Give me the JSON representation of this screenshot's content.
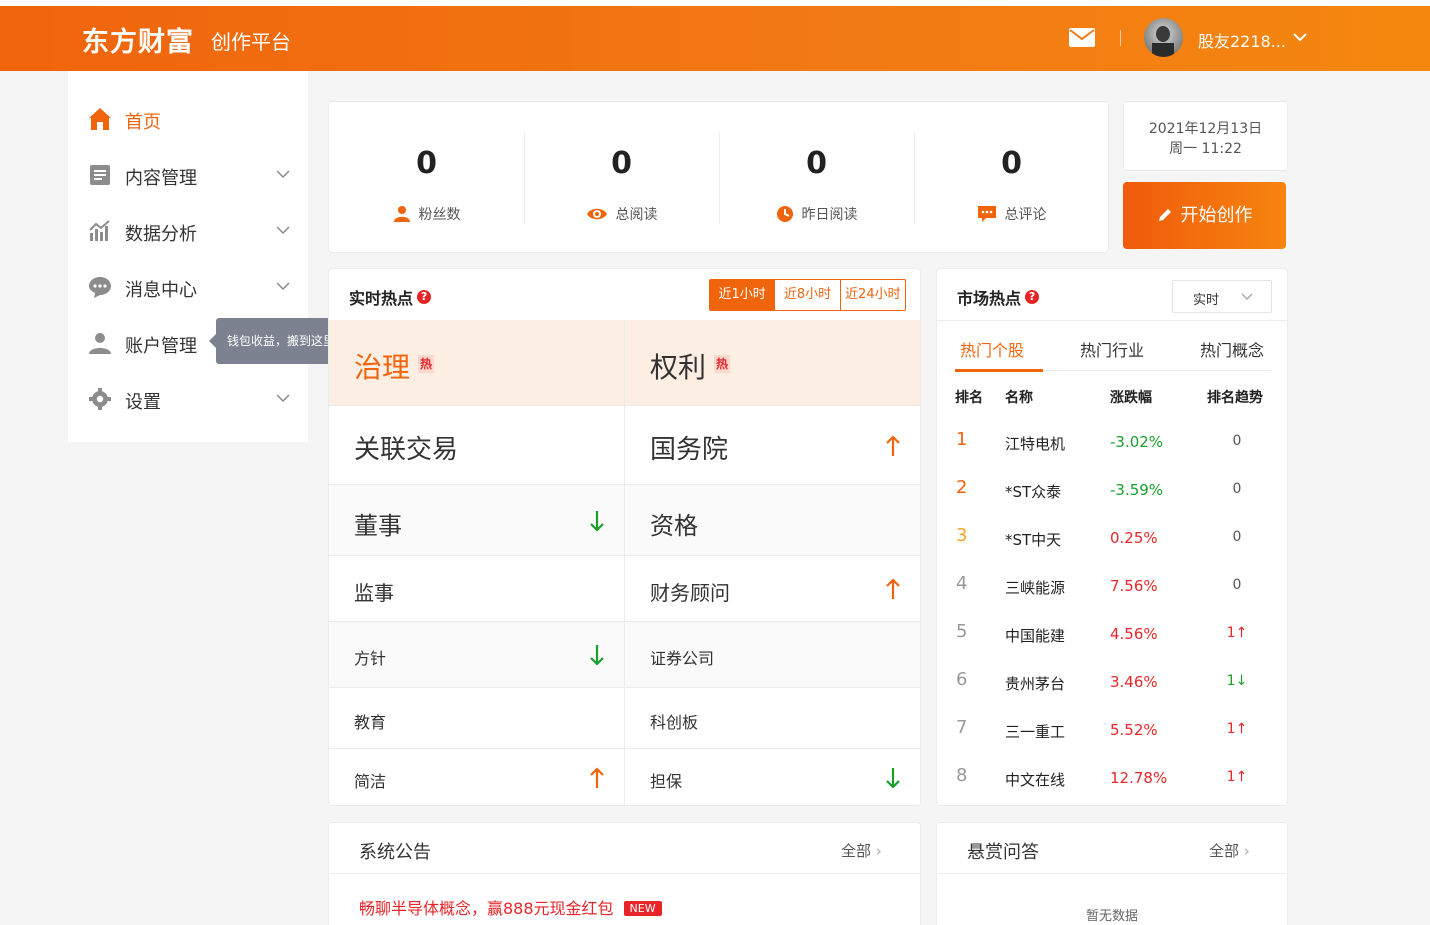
{
  "header": {
    "logo": "东方财富",
    "subtitle": "创作平台",
    "username": "股友2218..."
  },
  "sidebar": {
    "items": [
      {
        "label": "首页",
        "icon": "home-icon",
        "active": true
      },
      {
        "label": "内容管理",
        "icon": "document-icon"
      },
      {
        "label": "数据分析",
        "icon": "chart-icon"
      },
      {
        "label": "消息中心",
        "icon": "chat-icon"
      },
      {
        "label": "账户管理",
        "icon": "user-icon"
      },
      {
        "label": "设置",
        "icon": "gear-icon"
      }
    ],
    "tooltip": "钱包收益，搬到这里了!"
  },
  "stats": [
    {
      "value": "0",
      "label": "粉丝数",
      "icon": "fans-icon"
    },
    {
      "value": "0",
      "label": "总阅读",
      "icon": "eye-icon"
    },
    {
      "value": "0",
      "label": "昨日阅读",
      "icon": "clock-icon"
    },
    {
      "value": "0",
      "label": "总评论",
      "icon": "comment-icon"
    }
  ],
  "date": {
    "line1": "2021年12月13日",
    "line2": "周一 11:22"
  },
  "create_button": "开始创作",
  "hot": {
    "title": "实时热点",
    "ranges": [
      "近1小时",
      "近8小时",
      "近24小时"
    ],
    "hot_tag": "热",
    "cells": [
      {
        "text": "治理",
        "hot": true,
        "trend": ""
      },
      {
        "text": "权利",
        "hot": true,
        "trend": ""
      },
      {
        "text": "关联交易",
        "trend": ""
      },
      {
        "text": "国务院",
        "trend": "up"
      },
      {
        "text": "董事",
        "trend": "down"
      },
      {
        "text": "资格",
        "trend": ""
      },
      {
        "text": "监事",
        "trend": ""
      },
      {
        "text": "财务顾问",
        "trend": "up"
      },
      {
        "text": "方针",
        "trend": "down"
      },
      {
        "text": "证券公司",
        "trend": ""
      },
      {
        "text": "教育",
        "trend": ""
      },
      {
        "text": "科创板",
        "trend": ""
      },
      {
        "text": "简洁",
        "trend": "up"
      },
      {
        "text": "担保",
        "trend": "down"
      }
    ]
  },
  "market": {
    "title": "市场热点",
    "select": "实时",
    "tabs": [
      "热门个股",
      "热门行业",
      "热门概念"
    ],
    "headers": [
      "排名",
      "名称",
      "涨跌幅",
      "排名趋势"
    ],
    "rows": [
      {
        "rank": "1",
        "name": "江特电机",
        "change": "-3.02%",
        "trend": "0"
      },
      {
        "rank": "2",
        "name": "*ST众泰",
        "change": "-3.59%",
        "trend": "0"
      },
      {
        "rank": "3",
        "name": "*ST中天",
        "change": "0.25%",
        "trend": "0"
      },
      {
        "rank": "4",
        "name": "三峡能源",
        "change": "7.56%",
        "trend": "0"
      },
      {
        "rank": "5",
        "name": "中国能建",
        "change": "4.56%",
        "trend": "1↑"
      },
      {
        "rank": "6",
        "name": "贵州茅台",
        "change": "3.46%",
        "trend": "1↓"
      },
      {
        "rank": "7",
        "name": "三一重工",
        "change": "5.52%",
        "trend": "1↑"
      },
      {
        "rank": "8",
        "name": "中文在线",
        "change": "12.78%",
        "trend": "1↑"
      }
    ]
  },
  "notice": {
    "title": "系统公告",
    "all": "全部",
    "link": "畅聊半导体概念，赢888元现金红包",
    "badge": "NEW"
  },
  "qa": {
    "title": "悬赏问答",
    "all": "全部",
    "empty": "暂无数据"
  },
  "colors": {
    "accent": "#f0640c",
    "up": "#e8262a",
    "down": "#1a9e2c"
  }
}
